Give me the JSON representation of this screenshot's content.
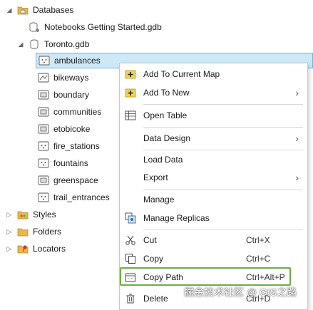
{
  "tree": {
    "databases": "Databases",
    "notebooks_gdb": "Notebooks Getting Started.gdb",
    "toronto_gdb": "Toronto.gdb",
    "layers": [
      "ambulances",
      "bikeways",
      "boundary",
      "communities",
      "etobicoke",
      "fire_stations",
      "fountains",
      "greenspace",
      "trail_entrances"
    ],
    "styles": "Styles",
    "folders": "Folders",
    "locators": "Locators"
  },
  "menu": {
    "add_to_current_map": "Add To Current Map",
    "add_to_new": "Add To New",
    "open_table": "Open Table",
    "data_design": "Data Design",
    "load_data": "Load Data",
    "export": "Export",
    "manage": "Manage",
    "manage_replicas": "Manage Replicas",
    "cut": "Cut",
    "cut_shortcut": "Ctrl+X",
    "copy": "Copy",
    "copy_shortcut": "Ctrl+C",
    "copy_path": "Copy Path",
    "copy_path_shortcut": "Ctrl+Alt+P",
    "delete": "Delete",
    "delete_shortcut": "Ctrl+D"
  },
  "watermark": "掘金技术社区 @ GIS之路",
  "colors": {
    "selection_bg": "#cde8f7",
    "selection_border": "#7ab3d9",
    "highlight": "#6fac46",
    "folder": "#e8b84a"
  }
}
